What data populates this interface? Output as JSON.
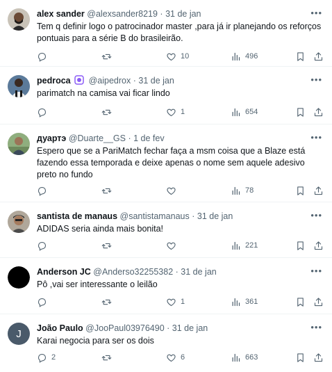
{
  "replies": [
    {
      "name": "alex sander",
      "handle": "@alexsander8219",
      "dot": "·",
      "date": "31 de jan",
      "text": "Tem q definir logo o patrocinador master ,para já ir planejando os reforços pontuais para a série B do brasileirão.",
      "reply_count": "",
      "repost_count": "",
      "like_count": "10",
      "view_count": "496",
      "avatar_icon": "photo-avatar-dark-beard",
      "more_icon": "more-icon"
    },
    {
      "name": "pedroca",
      "handle": "@aipedrox",
      "dot": "·",
      "date": "31 de jan",
      "text": "parimatch na camisa vai ficar lindo",
      "reply_count": "",
      "repost_count": "",
      "like_count": "1",
      "view_count": "654",
      "avatar_icon": "photo-avatar-team-shirt",
      "verified_icon": "verified-purple-badge-icon"
    },
    {
      "name": "дуартэ",
      "handle": "@Duarte__GS",
      "dot": "·",
      "date": "1 de fev",
      "text": "Espero que se a PariMatch fechar faça a msm coisa que a Blaze está fazendo essa temporada e deixe apenas o nome sem aquele adesivo preto no fundo",
      "reply_count": "",
      "repost_count": "",
      "like_count": "",
      "view_count": "78",
      "avatar_icon": "photo-avatar-outdoor"
    },
    {
      "name": "santista de manaus",
      "handle": "@santistamanaus",
      "dot": "·",
      "date": "31 de jan",
      "text": "ADIDAS seria ainda mais bonita!",
      "reply_count": "",
      "repost_count": "",
      "like_count": "",
      "view_count": "221",
      "avatar_icon": "photo-avatar-man-cap"
    },
    {
      "name": "Anderson JC",
      "handle": "@Anderso32255382",
      "dot": "·",
      "date": "31 de jan",
      "text": "Pô ,vai ser interessante o leilão",
      "reply_count": "",
      "repost_count": "",
      "like_count": "1",
      "view_count": "361",
      "avatar_icon": "black-circle-avatar"
    },
    {
      "name": "João Paulo",
      "handle": "@JooPaul03976490",
      "dot": "·",
      "date": "31 de jan",
      "text": "Karai negocia para ser os dois",
      "reply_count": "2",
      "repost_count": "",
      "like_count": "6",
      "view_count": "663",
      "avatar_icon": "initial-avatar",
      "avatar_letter": "J"
    }
  ],
  "colors": {
    "text_primary": "#0f1419",
    "text_secondary": "#536471",
    "border": "#eff3f4",
    "verified_purple": "#8b5cf6",
    "initial_avatar_bg": "#4a5a6a"
  }
}
